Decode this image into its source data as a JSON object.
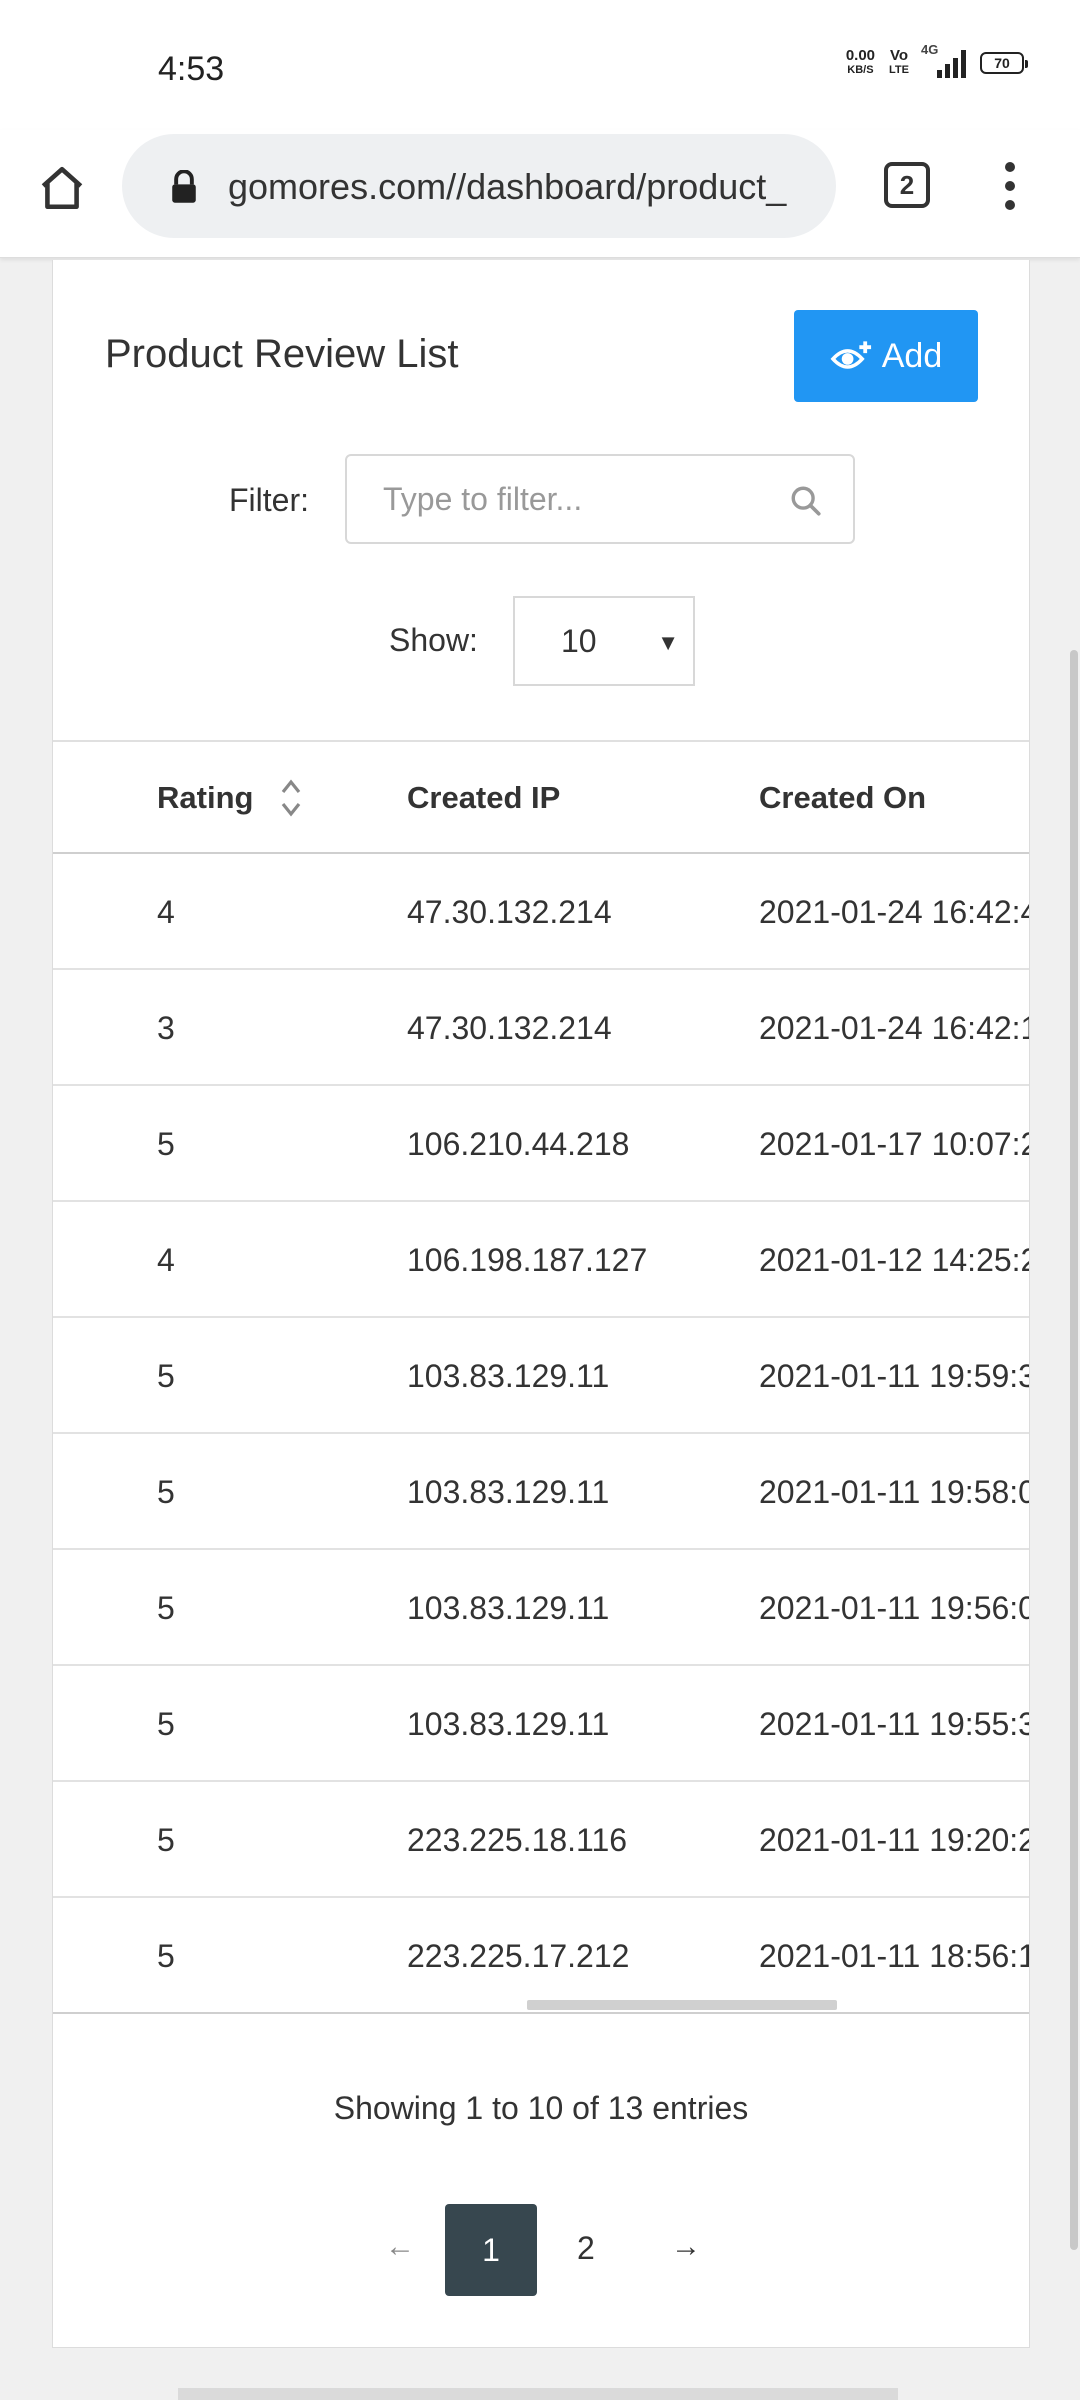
{
  "status_bar": {
    "time": "4:53",
    "speed_value": "0.00",
    "speed_unit": "KB/S",
    "volte_top": "Vo",
    "volte_bottom": "LTE",
    "network": "4G",
    "battery": "70"
  },
  "browser": {
    "url": "gomores.com//dashboard/product_",
    "tab_count": "2"
  },
  "card": {
    "title": "Product Review List",
    "add_label": "Add",
    "filter_label": "Filter:",
    "filter_placeholder": "Type to filter...",
    "filter_value": "",
    "show_label": "Show:",
    "show_value": "10"
  },
  "table": {
    "columns": [
      "Rating",
      "Created IP",
      "Created On"
    ],
    "rows": [
      {
        "rating": "4",
        "ip": "47.30.132.214",
        "created_on": "2021-01-24 16:42:4"
      },
      {
        "rating": "3",
        "ip": "47.30.132.214",
        "created_on": "2021-01-24 16:42:1"
      },
      {
        "rating": "5",
        "ip": "106.210.44.218",
        "created_on": "2021-01-17 10:07:2"
      },
      {
        "rating": "4",
        "ip": "106.198.187.127",
        "created_on": "2021-01-12 14:25:2"
      },
      {
        "rating": "5",
        "ip": "103.83.129.11",
        "created_on": "2021-01-11 19:59:3"
      },
      {
        "rating": "5",
        "ip": "103.83.129.11",
        "created_on": "2021-01-11 19:58:0"
      },
      {
        "rating": "5",
        "ip": "103.83.129.11",
        "created_on": "2021-01-11 19:56:0"
      },
      {
        "rating": "5",
        "ip": "103.83.129.11",
        "created_on": "2021-01-11 19:55:3"
      },
      {
        "rating": "5",
        "ip": "223.225.18.116",
        "created_on": "2021-01-11 19:20:2"
      },
      {
        "rating": "5",
        "ip": "223.225.17.212",
        "created_on": "2021-01-11 18:56:1"
      }
    ]
  },
  "footer": {
    "showing": "Showing 1 to 10 of 13 entries",
    "prev": "←",
    "page1": "1",
    "page2": "2",
    "next": "→"
  },
  "colors": {
    "accent": "#2196f3",
    "active_page": "#37474f"
  }
}
